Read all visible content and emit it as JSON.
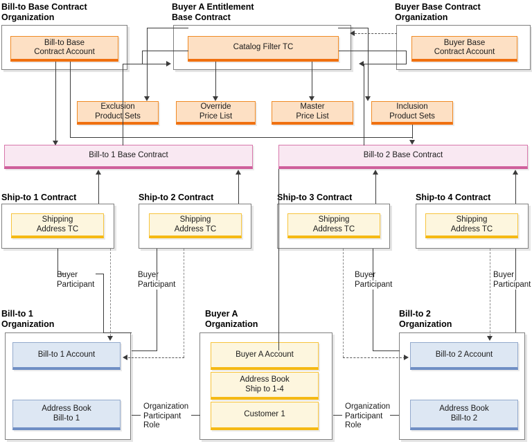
{
  "diagram": {
    "title": "Entitlement contract organization diagram",
    "colors": {
      "orange_fill": "#fde0c4",
      "orange_border": "#f08a24",
      "orange_accent": "#f07010",
      "yellow_fill": "#fdf6de",
      "yellow_border": "#f7c43c",
      "yellow_accent": "#f5b913",
      "blue_fill": "#dde7f3",
      "blue_border": "#93a9cc",
      "blue_accent": "#6f8ec4",
      "pink_fill": "#f9e8f2",
      "pink_border": "#d877ab",
      "pink_accent": "#cf5f9b",
      "group_border": "#7f7f7f",
      "line": "#3b3b3b"
    }
  },
  "groups": {
    "billto_base_contract_org": {
      "label": "Bill-to Base Contract\nOrganization"
    },
    "buyer_a_entitlement_base_contract": {
      "label": "Buyer A Entitlement\nBase Contract"
    },
    "buyer_base_contract_org": {
      "label": "Buyer Base Contract\nOrganization"
    },
    "shipto_1_contract": {
      "label": "Ship-to 1 Contract"
    },
    "shipto_2_contract": {
      "label": "Ship-to 2 Contract"
    },
    "shipto_3_contract": {
      "label": "Ship-to 3 Contract"
    },
    "shipto_4_contract": {
      "label": "Ship-to 4 Contract"
    },
    "billto_1_org": {
      "label": "Bill-to 1\nOrganization"
    },
    "buyer_a_org": {
      "label": "Buyer A\nOrganization"
    },
    "billto_2_org": {
      "label": "Bill-to 2\nOrganization"
    }
  },
  "nodes": {
    "billto_base_contract_account": "Bill-to Base\nContract Account",
    "catalog_filter_tc": "Catalog Filter TC",
    "buyer_base_contract_account": "Buyer Base\nContract Account",
    "exclusion_product_sets": "Exclusion\nProduct Sets",
    "override_price_list": "Override\nPrice List",
    "master_price_list": "Master\nPrice List",
    "inclusion_product_sets": "Inclusion\nProduct Sets",
    "billto_1_base_contract": "Bill-to 1 Base Contract",
    "billto_2_base_contract": "Bill-to 2 Base Contract",
    "shipping_address_tc_1": "Shipping\nAddress TC",
    "shipping_address_tc_2": "Shipping\nAddress TC",
    "shipping_address_tc_3": "Shipping\nAddress TC",
    "shipping_address_tc_4": "Shipping\nAddress TC",
    "billto_1_account": "Bill-to 1 Account",
    "address_book_billto_1": "Address Book\nBill-to 1",
    "buyer_a_account": "Buyer A Account",
    "address_book_ship_to_1_4": "Address Book\nShip to 1-4",
    "customer_1": "Customer 1",
    "billto_2_account": "Bill-to 2 Account",
    "address_book_billto_2": "Address Book\nBill-to 2"
  },
  "edge_labels": {
    "buyer_participant_1": "Buyer\nParticipant",
    "buyer_participant_2": "Buyer\nParticipant",
    "buyer_participant_3": "Buyer\nParticipant",
    "buyer_participant_4": "Buyer\nParticipant",
    "organization_participant_role_left": "Organization\nParticipant\nRole",
    "organization_participant_role_right": "Organization\nParticipant\nRole"
  }
}
